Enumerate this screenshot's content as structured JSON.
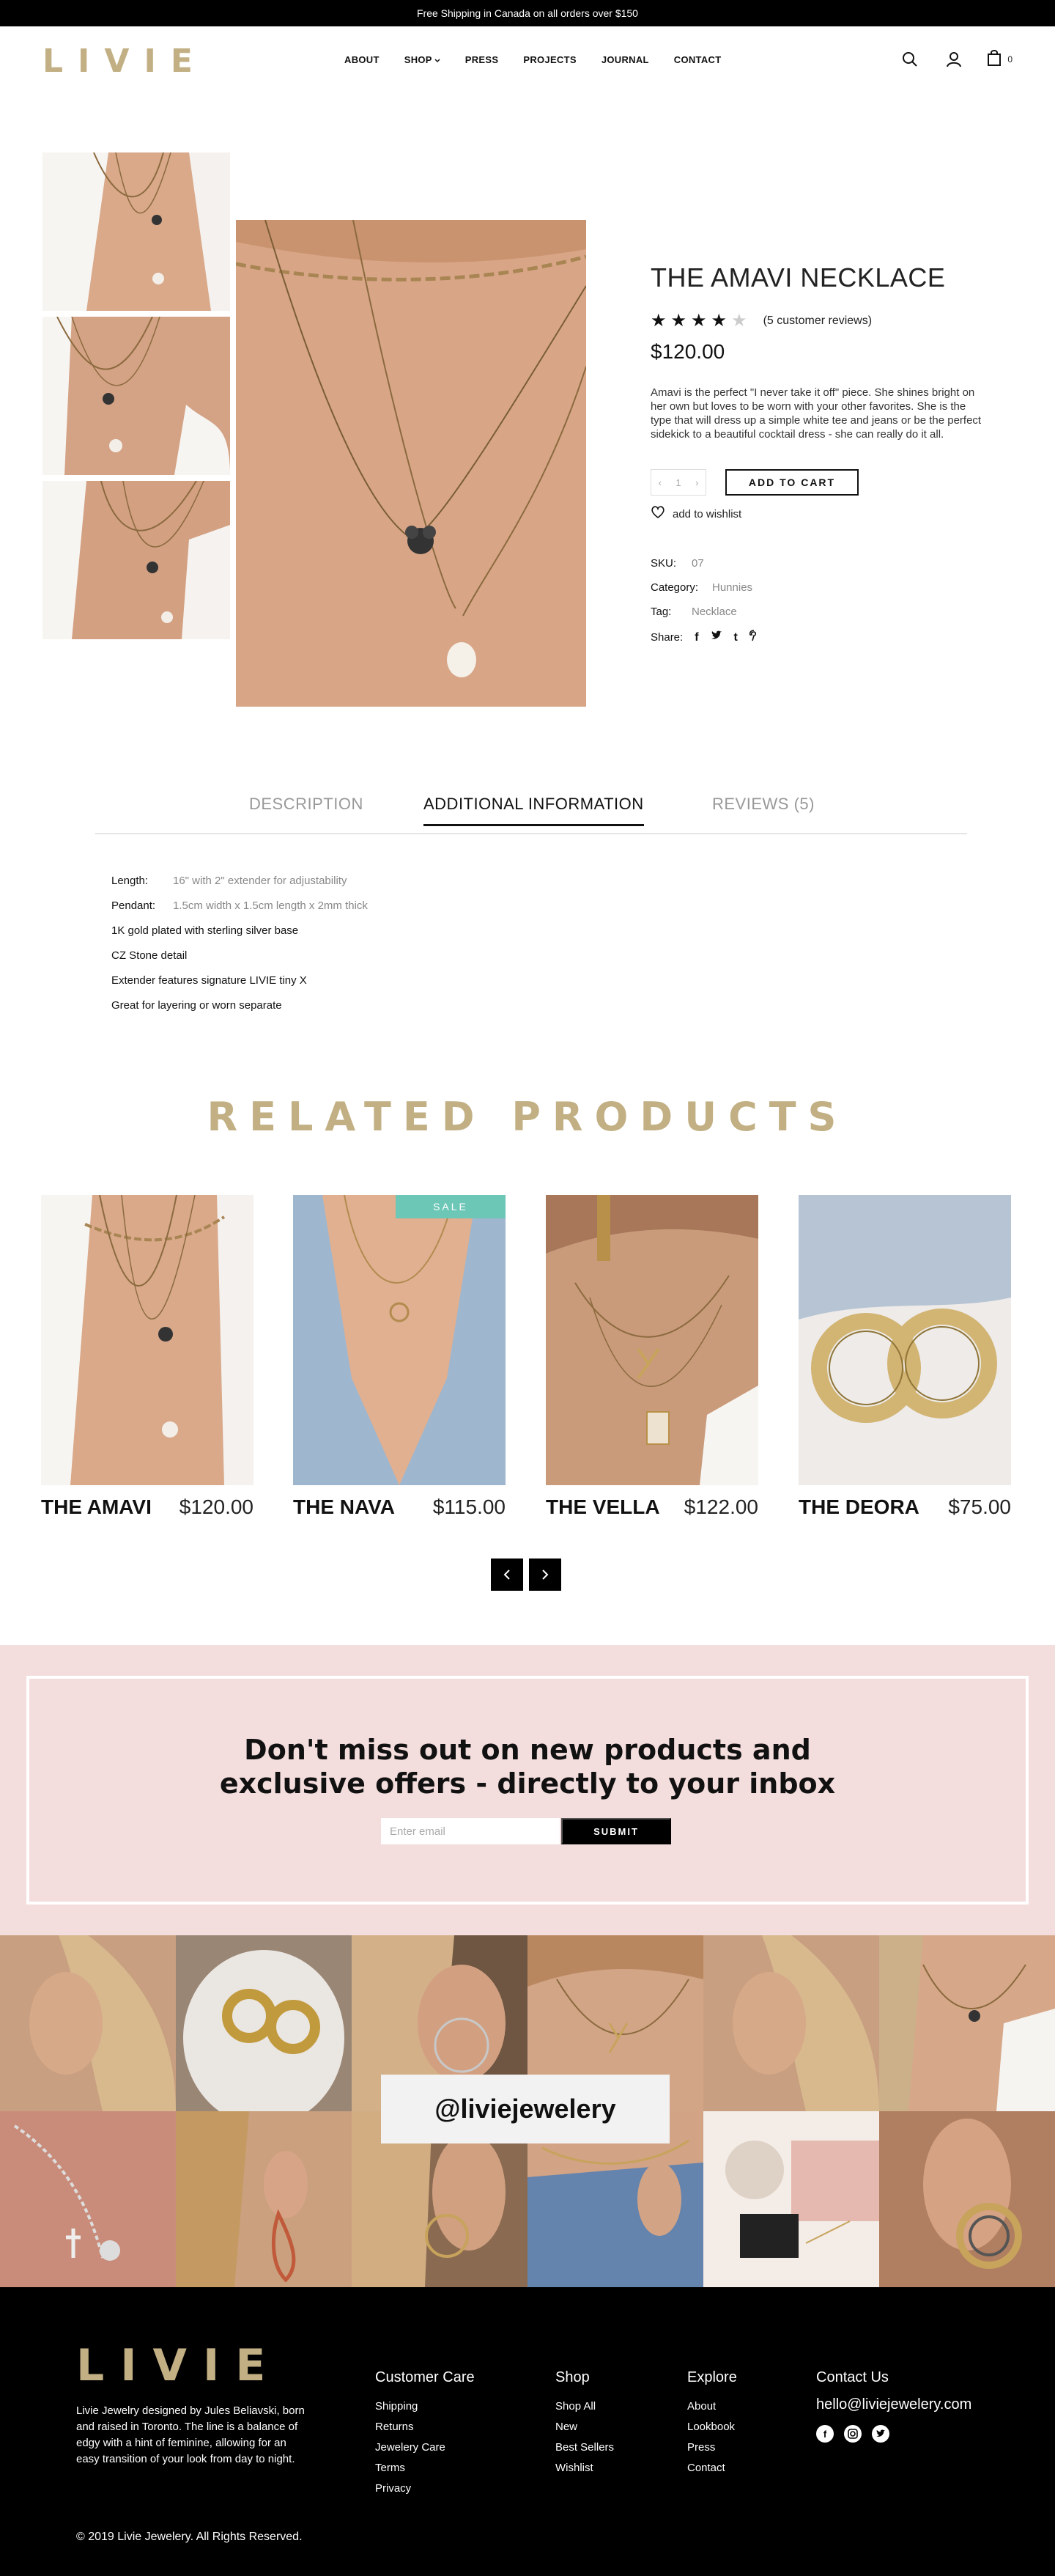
{
  "banner": "Free Shipping in Canada on all orders over $150",
  "brand": "LIVIE",
  "nav": [
    "ABOUT",
    "SHOP",
    "PRESS",
    "PROJECTS",
    "JOURNAL",
    "CONTACT"
  ],
  "header": {
    "cart_count": "0"
  },
  "product": {
    "title": "THE AMAVI NECKLACE",
    "rating": 4,
    "reviews_text": "(5 customer reviews)",
    "price": "$120.00",
    "description": "Amavi is the perfect \"I never take it off\" piece. She shines bright on her own but loves to be worn with your other favorites. She is the type that will dress up a simple white tee and jeans or be the perfect sidekick to a beautiful cocktail dress - she can really do it all.",
    "qty": "1",
    "add_to_cart": "ADD TO CART",
    "wishlist": "add to wishlist",
    "sku_label": "SKU:",
    "sku": "07",
    "category_label": "Category:",
    "category": "Hunnies",
    "tag_label": "Tag:",
    "tag": "Necklace",
    "share_label": "Share:"
  },
  "tabs": [
    "DESCRIPTION",
    "ADDITIONAL INFORMATION",
    "REVIEWS (5)"
  ],
  "additional": {
    "length_label": "Length:",
    "length": "16\" with 2\" extender for adjustability",
    "pendant_label": "Pendant:",
    "pendant": "1.5cm width x 1.5cm length x 2mm thick",
    "lines": [
      "1K gold plated with sterling silver base",
      "CZ Stone detail",
      "Extender features signature LIVIE tiny X",
      "Great for layering or worn separate"
    ]
  },
  "related": {
    "title": "RELATED PRODUCTS",
    "items": [
      {
        "name": "THE AMAVI",
        "price": "$120.00"
      },
      {
        "name": "THE NAVA",
        "price": "$115.00",
        "badge": "SALE"
      },
      {
        "name": "THE VELLA",
        "price": "$122.00"
      },
      {
        "name": "THE DEORA",
        "price": "$75.00"
      }
    ]
  },
  "newsletter": {
    "title_line1": "Don't miss out on new products and",
    "title_line2": "exclusive offers - directly to your inbox",
    "placeholder": "Enter email",
    "submit": "SUBMIT"
  },
  "instagram": {
    "handle": "@liviejewelery"
  },
  "footer": {
    "about": "Livie Jewelry designed by Jules Beliavski, born and raised in Toronto. The line is a balance of edgy with a hint of feminine, allowing for an easy transition of your look from day to night.",
    "customer_care": {
      "title": "Customer Care",
      "links": [
        "Shipping",
        "Returns",
        "Jewelery Care",
        "Terms",
        "Privacy"
      ]
    },
    "shop": {
      "title": "Shop",
      "links": [
        "Shop All",
        "New",
        "Best Sellers",
        "Wishlist"
      ]
    },
    "explore": {
      "title": "Explore",
      "links": [
        "About",
        "Lookbook",
        "Press",
        "Contact"
      ]
    },
    "contact": {
      "title": "Contact Us",
      "email": "hello@liviejewelery.com"
    },
    "copyright": "© 2019 Livie Jewelery.  All Rights Reserved."
  },
  "colors": {
    "gold": "#c2b084",
    "sale": "#6cc7b6",
    "pink": "#f4dddd"
  }
}
